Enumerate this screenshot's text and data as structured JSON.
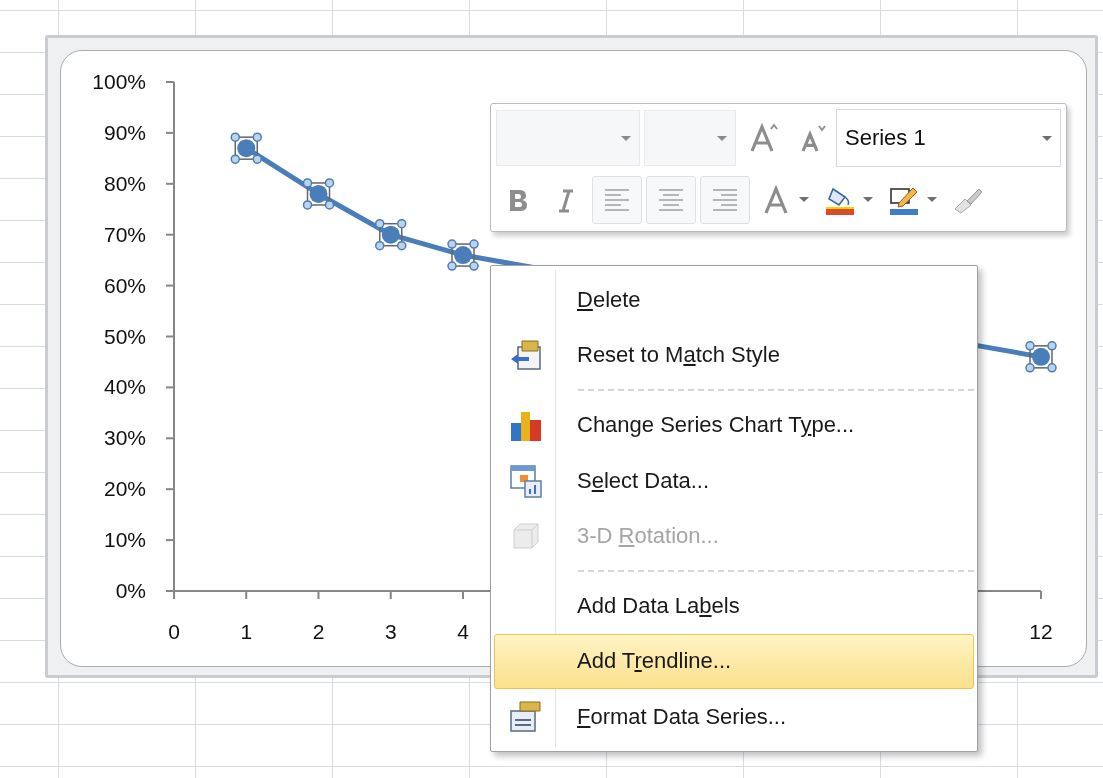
{
  "chart": {
    "chart_data": {
      "type": "line",
      "x": [
        1,
        2,
        3,
        4,
        5,
        6,
        7,
        8,
        9,
        10,
        11,
        12
      ],
      "xlim": [
        0,
        12
      ],
      "ylim": [
        0,
        1
      ],
      "xticks": [
        0,
        1,
        2,
        3,
        4,
        12
      ],
      "yticks": [
        {
          "value": 0,
          "label": "0%"
        },
        {
          "value": 0.1,
          "label": "10%"
        },
        {
          "value": 0.2,
          "label": "20%"
        },
        {
          "value": 0.3,
          "label": "30%"
        },
        {
          "value": 0.4,
          "label": "40%"
        },
        {
          "value": 0.5,
          "label": "50%"
        },
        {
          "value": 0.6,
          "label": "60%"
        },
        {
          "value": 0.7,
          "label": "70%"
        },
        {
          "value": 0.8,
          "label": "80%"
        },
        {
          "value": 0.9,
          "label": "90%"
        },
        {
          "value": 1,
          "label": "100%"
        }
      ],
      "series": [
        {
          "name": "Series 1",
          "color": "#4a7ebb",
          "marker": "circle",
          "values": [
            0.87,
            0.78,
            0.7,
            0.66,
            null,
            null,
            null,
            null,
            null,
            null,
            null,
            0.46
          ]
        }
      ]
    }
  },
  "mini_toolbar": {
    "rows": [
      [
        {
          "kind": "combo",
          "disabled": true
        },
        {
          "kind": "combo-small",
          "disabled": true
        },
        {
          "kind": "grow-font",
          "disabled": true
        },
        {
          "kind": "shrink-font",
          "disabled": true
        },
        {
          "kind": "series-combo",
          "disabled": false
        }
      ],
      [
        {
          "kind": "bold",
          "disabled": true
        },
        {
          "kind": "italic",
          "disabled": true
        },
        {
          "kind": "align-left",
          "disabled": true
        },
        {
          "kind": "align-center",
          "disabled": true
        },
        {
          "kind": "align-right",
          "disabled": true
        },
        {
          "kind": "font-color",
          "disabled": true
        },
        {
          "kind": "fill",
          "disabled": false
        },
        {
          "kind": "outline",
          "disabled": false
        },
        {
          "kind": "painter",
          "disabled": false
        }
      ]
    ]
  },
  "context_menu": {
    "items": [
      {
        "kind": "item",
        "access_key": "D",
        "text_after": "elete",
        "disabled": false,
        "selected": false
      },
      {
        "kind": "item",
        "text_before": "Reset to M",
        "access_key": "a",
        "text_after": "tch Style",
        "disabled": false,
        "selected": false
      },
      {
        "kind": "separator"
      },
      {
        "kind": "item",
        "text_before": "Change Series Chart T",
        "access_key": "y",
        "text_after": "pe...",
        "disabled": false,
        "selected": false
      },
      {
        "kind": "item",
        "text_before": "S",
        "access_key": "e",
        "text_after": "lect Data...",
        "disabled": false,
        "selected": false
      },
      {
        "kind": "item",
        "text_before": "3-D ",
        "access_key": "R",
        "text_after": "otation...",
        "disabled": true,
        "selected": false
      },
      {
        "kind": "separator"
      },
      {
        "kind": "item",
        "text_before": "Add Data La",
        "access_key": "b",
        "text_after": "els",
        "disabled": false,
        "selected": false
      },
      {
        "kind": "item",
        "text_before": "Add T",
        "access_key": "r",
        "text_after": "endline...",
        "disabled": false,
        "selected": true
      },
      {
        "kind": "item",
        "access_key": "F",
        "text_after": "ormat Data Series...",
        "disabled": false,
        "selected": false
      }
    ]
  }
}
